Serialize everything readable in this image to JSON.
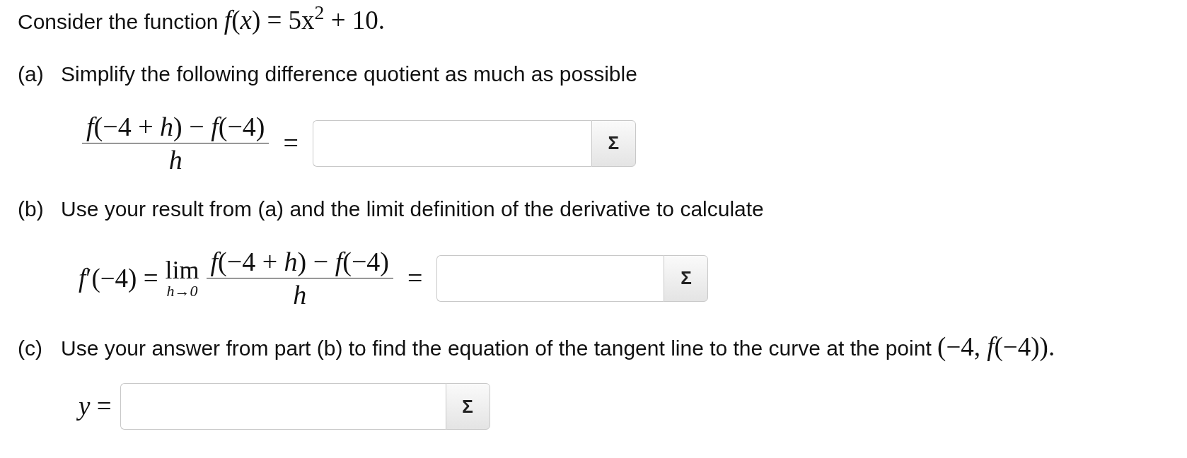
{
  "intro": {
    "text": "Consider the function",
    "formula": "*f*(*x*) = 5x$^{2}$ + 10."
  },
  "parts": [
    {
      "label": "(a)",
      "text": "Simplify the following difference quotient as much as possible",
      "equation": {
        "fraction": {
          "numerator": "*f*(−4 + *h*) − *f*(−4)",
          "denominator": "h"
        },
        "equals": "="
      },
      "answer": {
        "button": "Σ"
      }
    },
    {
      "label": "(b)",
      "text": "Use your result from (a) and the limit definition of the derivative to calculate",
      "equation": {
        "prefix": "*f*′(−4) =",
        "limit": {
          "word": "lim",
          "sub": "h→0"
        },
        "fraction": {
          "numerator": "*f*(−4 + *h*) − *f*(−4)",
          "denominator": "h"
        },
        "equals": "="
      },
      "answer": {
        "button": "Σ"
      }
    },
    {
      "label": "(c)",
      "text": "Use your answer from part (b) to find the equation of the tangent line to the curve at the point",
      "formula": "(−4, *f*(−4)).",
      "equation": {
        "prefix": "*y* ="
      },
      "answer": {
        "button": "Σ"
      }
    }
  ]
}
